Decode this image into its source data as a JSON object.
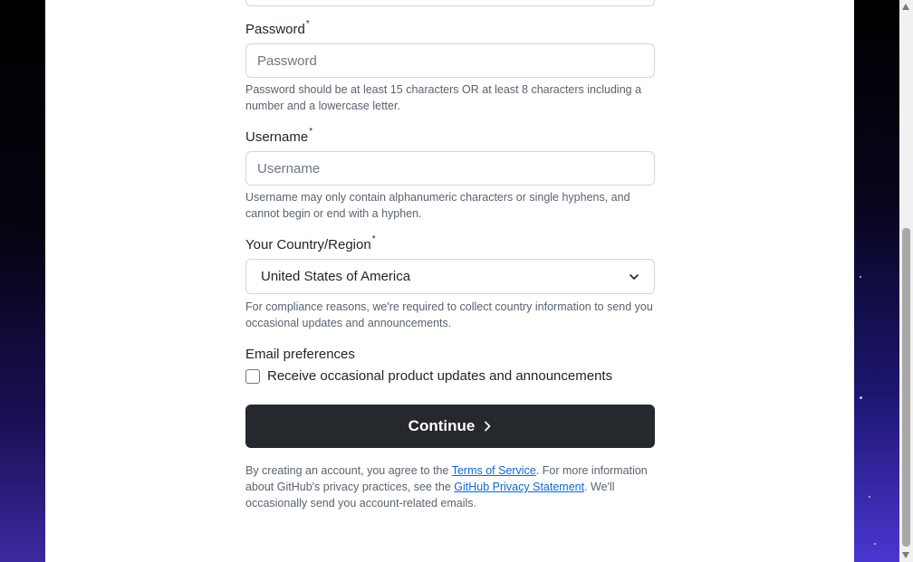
{
  "form": {
    "password": {
      "label": "Password",
      "required_mark": "*",
      "placeholder": "Password",
      "hint": "Password should be at least 15 characters OR at least 8 characters including a number and a lowercase letter."
    },
    "username": {
      "label": "Username",
      "required_mark": "*",
      "placeholder": "Username",
      "hint": "Username may only contain alphanumeric characters or single hyphens, and cannot begin or end with a hyphen."
    },
    "country": {
      "label": "Your Country/Region",
      "required_mark": "*",
      "selected": "United States of America",
      "hint": "For compliance reasons, we're required to collect country information to send you occasional updates and announcements."
    },
    "email_prefs": {
      "label": "Email preferences",
      "checkbox_label": "Receive occasional product updates and announcements",
      "checked": false
    },
    "continue_label": "Continue"
  },
  "legal": {
    "text_1": "By creating an account, you agree to the ",
    "terms_link": "Terms of Service",
    "text_2": ". For more information about GitHub's privacy practices, see the ",
    "privacy_link": "GitHub Privacy Statement",
    "text_3": ". We'll occasionally send you account-related emails."
  },
  "icons": {
    "chevron": "chevron-down-icon",
    "continue_arrow": "chevron-right-icon"
  },
  "colors": {
    "button_bg": "#25292e",
    "link": "#0969da",
    "hint_text": "#59636e",
    "border": "#d0d7de"
  }
}
